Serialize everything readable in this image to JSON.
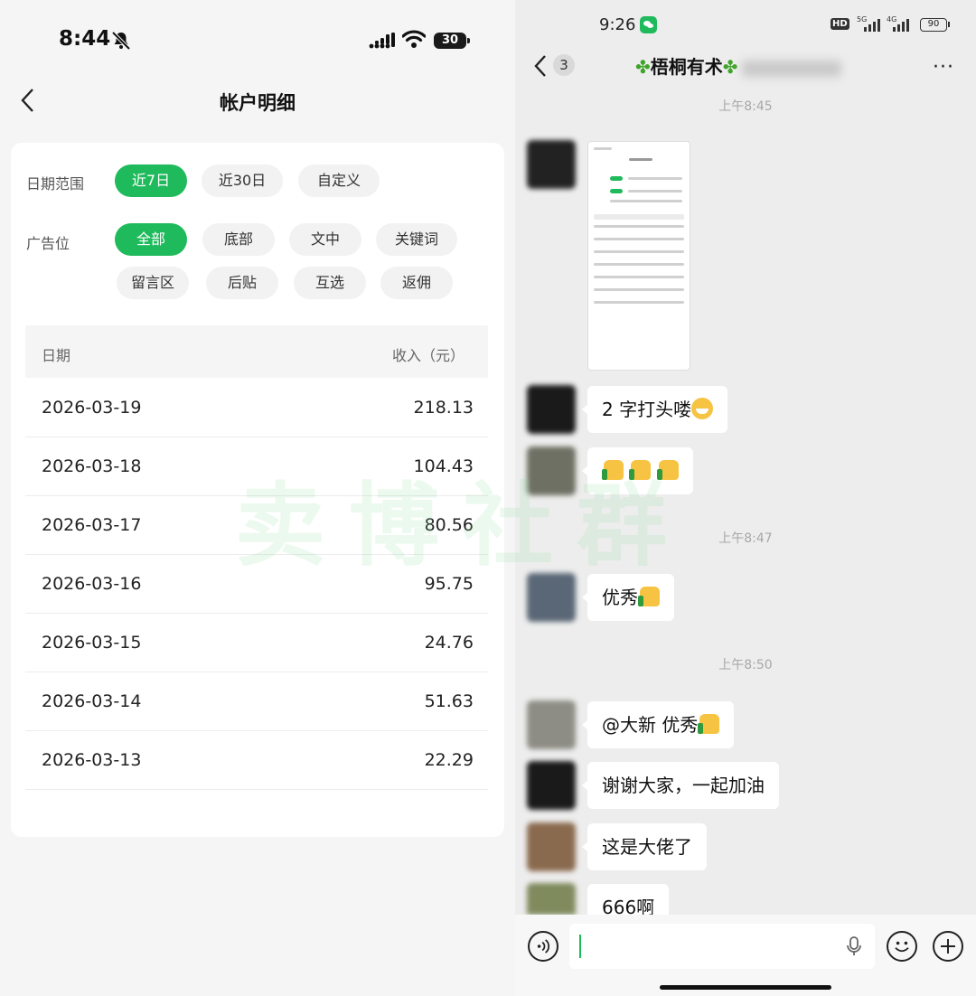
{
  "left": {
    "status_time": "8:44",
    "battery": "30",
    "title": "帐户明细",
    "date_range_label": "日期范围",
    "date_ranges": [
      "近7日",
      "近30日",
      "自定义"
    ],
    "ad_slot_label": "广告位",
    "ad_slots": [
      "全部",
      "底部",
      "文中",
      "关键词",
      "留言区",
      "后贴",
      "互选",
      "返佣"
    ],
    "table_header": {
      "date": "日期",
      "income": "收入（元）"
    },
    "rows": [
      {
        "date": "2026-03-19",
        "value": "218.13"
      },
      {
        "date": "2026-03-18",
        "value": "104.43"
      },
      {
        "date": "2026-03-17",
        "value": "80.56"
      },
      {
        "date": "2026-03-16",
        "value": "95.75"
      },
      {
        "date": "2026-03-15",
        "value": "24.76"
      },
      {
        "date": "2026-03-14",
        "value": "51.63"
      },
      {
        "date": "2026-03-13",
        "value": "22.29"
      }
    ],
    "watermark": "卖博社群"
  },
  "right": {
    "status_time": "9:26",
    "hd": "HD",
    "net_5g": "5G",
    "net_4g": "4G",
    "battery": "90",
    "unread_count": "3",
    "chat_title": "梧桐有术",
    "more": "···",
    "stamps": [
      "上午8:45",
      "上午8:47",
      "上午8:50"
    ],
    "messages": [
      {
        "text": "2 字打头喽"
      },
      {
        "text": ""
      },
      {
        "text": "优秀"
      },
      {
        "text": "@大新  优秀"
      },
      {
        "text": "谢谢大家，一起加油"
      },
      {
        "text": "这是大佬了"
      },
      {
        "text": "666啊"
      }
    ]
  }
}
